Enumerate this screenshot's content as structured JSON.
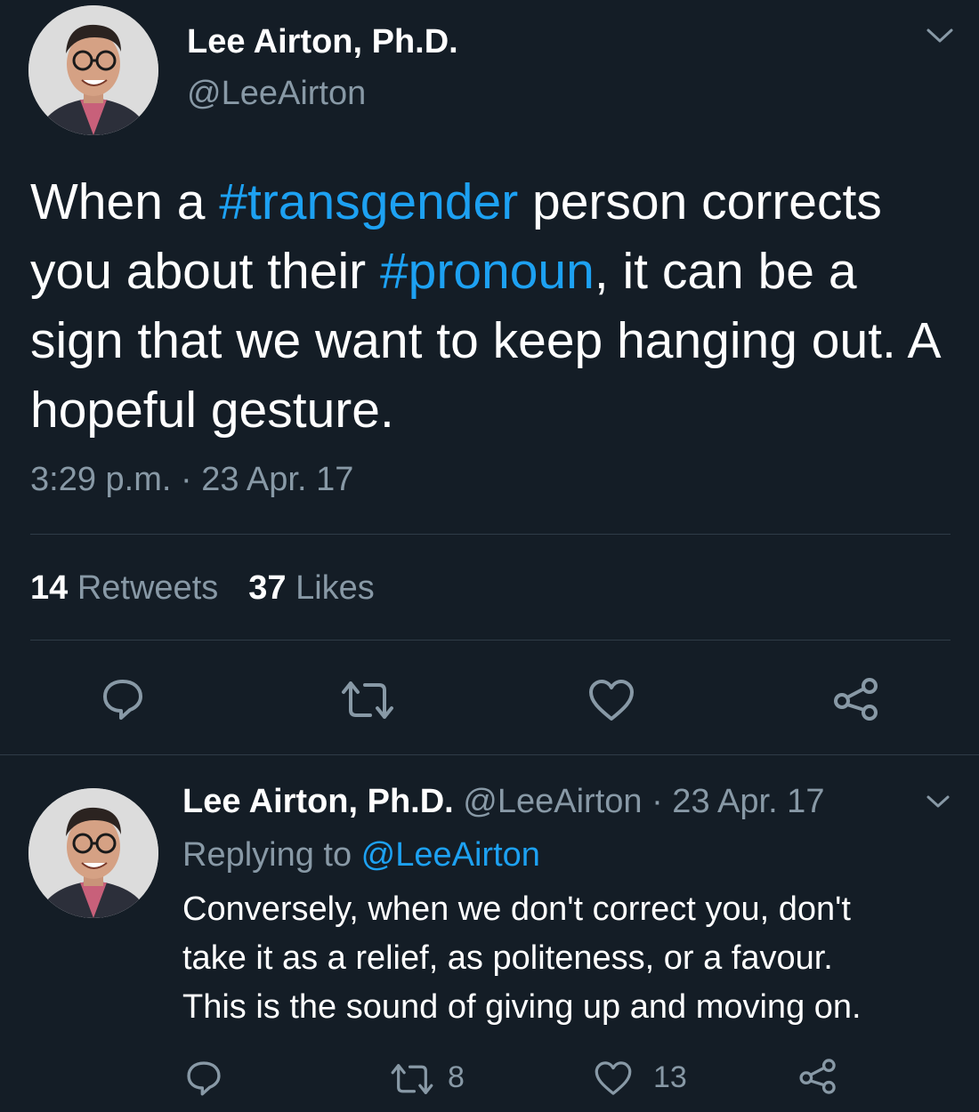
{
  "main_tweet": {
    "author_name": "Lee Airton, Ph.D.",
    "author_handle": "@LeeAirton",
    "text_parts": [
      "When a ",
      "#transgender",
      " person corrects you about their ",
      "#pronoun",
      ", it can be a sign that we want to keep hanging out. A hopeful gesture."
    ],
    "timestamp": "3:29 p.m. · 23 Apr. 17",
    "retweets_count": "14",
    "retweets_label": "Retweets",
    "likes_count": "37",
    "likes_label": "Likes",
    "icons": [
      "reply-icon",
      "retweet-icon",
      "like-icon",
      "share-icon",
      "chevron-down-icon"
    ]
  },
  "reply_tweet": {
    "author_name": "Lee Airton, Ph.D.",
    "meta": " @LeeAirton · 23 Apr. 17",
    "replying_prefix": "Replying to ",
    "replying_to": "@LeeAirton",
    "text_lines": [
      "Conversely, when we don't correct you, don't",
      "take it as a relief, as politeness, or a favour.",
      "This is the sound of giving up and moving on."
    ],
    "retweet_count": "8",
    "like_count": "13",
    "icons": [
      "reply-icon",
      "retweet-icon",
      "like-icon",
      "share-icon",
      "chevron-down-icon"
    ]
  },
  "colors": {
    "background": "#141d26",
    "text": "#ffffff",
    "muted": "#8899a6",
    "accent": "#1da1f2"
  }
}
